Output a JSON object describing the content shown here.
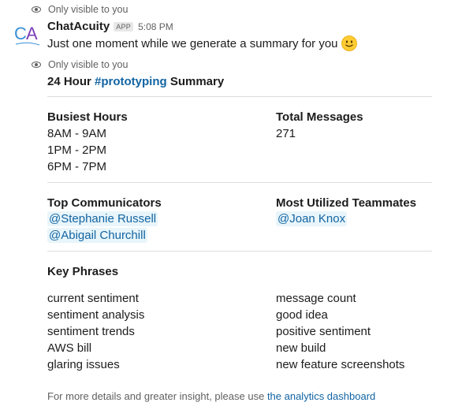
{
  "ephemeral_notice": "Only visible to you",
  "sender": {
    "name": "ChatAcuity",
    "badge": "APP",
    "time": "5:08 PM",
    "avatar_text": "CA"
  },
  "intro_message": "Just one moment while we generate a summary for you",
  "summary": {
    "title_prefix": "24 Hour ",
    "channel": "#prototyping",
    "title_suffix": " Summary"
  },
  "busiest_hours": {
    "title": "Busiest Hours",
    "items": [
      "8AM - 9AM",
      "1PM - 2PM",
      "6PM - 7PM"
    ]
  },
  "total_messages": {
    "title": "Total Messages",
    "value": "271"
  },
  "top_communicators": {
    "title": "Top Communicators",
    "items": [
      "@Stephanie Russell",
      "@Abigail Churchill"
    ]
  },
  "most_utilized": {
    "title": "Most Utilized Teammates",
    "items": [
      "@Joan Knox"
    ]
  },
  "key_phrases": {
    "title": "Key Phrases",
    "left": [
      "current sentiment",
      "sentiment analysis",
      "sentiment trends",
      "AWS bill",
      "glaring issues"
    ],
    "right": [
      "message count",
      "good idea",
      "positive sentiment",
      "new build",
      "new feature screenshots"
    ]
  },
  "footer": {
    "text": "For more details and greater insight, please use ",
    "link": "the analytics dashboard"
  },
  "colors": {
    "link": "#1264a3",
    "mention_bg": "#e8f5fa",
    "muted": "#616061"
  }
}
